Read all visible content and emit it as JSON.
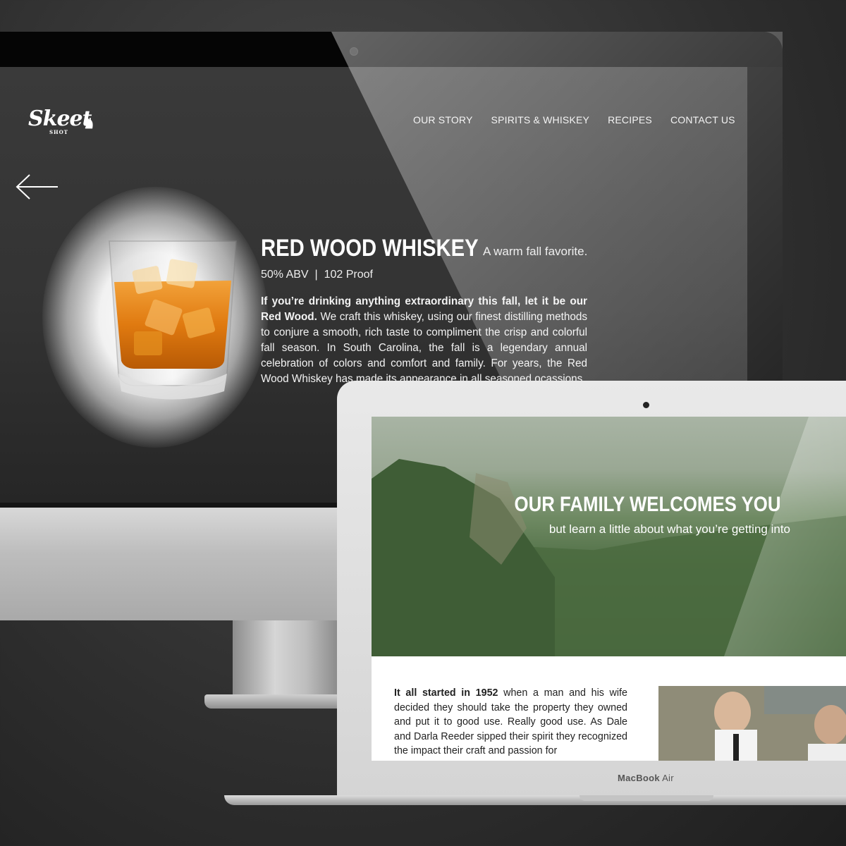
{
  "imac_site": {
    "logo": {
      "text": "Skeet",
      "sub": "SHOT"
    },
    "nav": [
      "OUR STORY",
      "SPIRITS & WHISKEY",
      "RECIPES",
      "CONTACT US"
    ],
    "product": {
      "name": "RED WOOD WHISKEY",
      "tagline": "A warm fall favorite.",
      "abv": "50% ABV",
      "proof": "102 Proof",
      "description_lead": "If you’re drinking anything extraordinary this fall, let it be our Red Wood.",
      "description_body": " We craft this whiskey, using our finest distilling methods to conjure a smooth, rich taste to compliment the crisp and colorful fall season.  In South Carolina, the fall is a legendary annual celebration of colors and comfort and family. For years, the Red Wood Whiskey has made its appearance in all seasoned ocassions."
    }
  },
  "laptop_site": {
    "hero_title": "OUR FAMILY WELCOMES YOU",
    "hero_subtitle": "but learn a little about what you’re getting into",
    "story_lead": "It all started in 1952",
    "story_body": " when a man and his wife decided they should take the property they owned and put it to good use. Really good use. As Dale and Darla Reeder sipped their spirit they recognized the impact their craft and passion for"
  },
  "laptop_brand": {
    "model": "MacBook",
    "suffix": " Air"
  }
}
